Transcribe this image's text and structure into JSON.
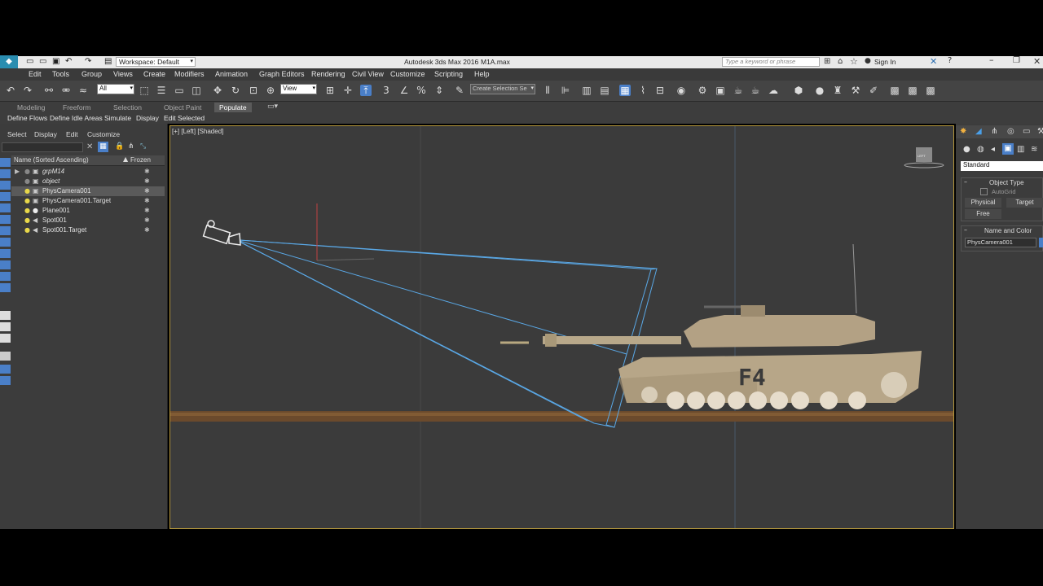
{
  "titlebar": {
    "workspace_label": "Workspace: Default",
    "app_title": "Autodesk 3ds Max 2016",
    "file_name": "M1A.max",
    "search_placeholder": "Type a keyword or phrase",
    "sign_in": "Sign In"
  },
  "menu": [
    "Edit",
    "Tools",
    "Group",
    "Views",
    "Create",
    "Modifiers",
    "Animation",
    "Graph Editors",
    "Rendering",
    "Civil View",
    "Customize",
    "Scripting",
    "Help"
  ],
  "toolbar": {
    "filter_value": "All",
    "refcoord_value": "View",
    "selection_set_placeholder": "Create Selection Se"
  },
  "ribbon_tabs": [
    "Modeling",
    "Freeform",
    "Selection",
    "Object Paint",
    "Populate"
  ],
  "ribbon_active": "Populate",
  "ribbon_items": [
    "Define Flows",
    "Define Idle Areas",
    "Simulate",
    "Display",
    "Edit Selected"
  ],
  "scene_explorer": {
    "menu": [
      "Select",
      "Display",
      "Edit",
      "Customize"
    ],
    "col_name": "Name (Sorted Ascending)",
    "col_frozen": "Frozen",
    "rows": [
      {
        "name": "grpM14",
        "selected": false,
        "expand": true
      },
      {
        "name": "object",
        "selected": false,
        "expand": false
      },
      {
        "name": "PhysCamera001",
        "selected": true,
        "expand": false
      },
      {
        "name": "PhysCamera001.Target",
        "selected": false,
        "expand": false
      },
      {
        "name": "Plane001",
        "selected": false,
        "expand": false
      },
      {
        "name": "Spot001",
        "selected": false,
        "expand": false
      },
      {
        "name": "Spot001.Target",
        "selected": false,
        "expand": false
      }
    ]
  },
  "viewport": {
    "label": "[+] [Left] [Shaded]",
    "tank_marking": "F4",
    "viewcube_label": "LEFT"
  },
  "command_panel": {
    "category": "Standard",
    "object_type_header": "Object Type",
    "autogrid": "AutoGrid",
    "buttons": [
      "Physical",
      "Target",
      "Free"
    ],
    "name_color_header": "Name and Color",
    "object_name": "PhysCamera001"
  },
  "colors": {
    "accent_blue": "#4a7fc8",
    "viewport_border": "#b89a3c",
    "frustum": "#5aa8e6"
  }
}
